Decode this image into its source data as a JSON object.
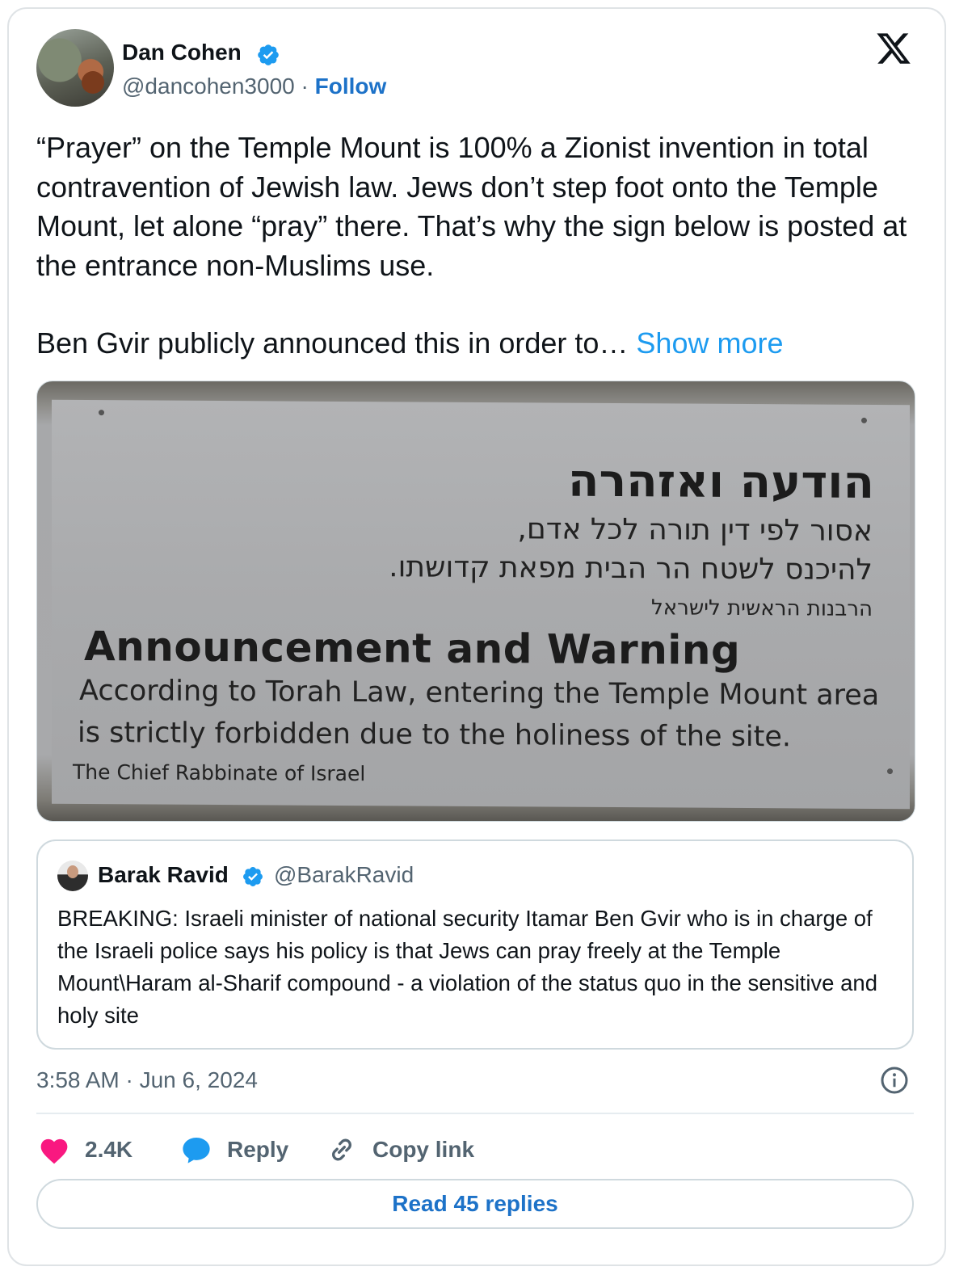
{
  "author": {
    "name": "Dan Cohen",
    "handle": "@dancohen3000",
    "separator": "·",
    "follow_label": "Follow"
  },
  "tweet": {
    "text": "“Prayer” on the Temple Mount is 100% a Zionist invention in total contravention of Jewish law. Jews don’t step foot onto the Temple Mount, let alone “pray” there. That’s why the sign below is posted at the entrance non-Muslims use.",
    "text2": "Ben Gvir publicly announced this in order to…",
    "show_more": "Show more"
  },
  "photo": {
    "hebrew_title": "הודעה ואזהרה",
    "hebrew_line1": "אסור לפי דין תורה לכל אדם,",
    "hebrew_line2": "להיכנס לשטח הר הבית מפאת קדושתו.",
    "hebrew_line3": "הרבנות הראשית לישראל",
    "english_title": "Announcement and Warning",
    "english_line1": "According to Torah Law, entering the Temple Mount area",
    "english_line2": "is strictly forbidden due to the holiness of the site.",
    "english_line3": "The Chief Rabbinate of Israel"
  },
  "quoted_tweet": {
    "name": "Barak Ravid",
    "handle": "@BarakRavid",
    "text": "BREAKING: Israeli minister of national security Itamar Ben Gvir who is in charge of the Israeli police says his policy is that Jews can pray freely at the Temple Mount\\Haram al-Sharif compound - a violation of the status quo in the sensitive and holy site"
  },
  "timestamp": "3:58 AM · Jun 6, 2024",
  "actions": {
    "likes": "2.4K",
    "reply_label": "Reply",
    "copy_link_label": "Copy link"
  },
  "read_replies_label": "Read 45 replies",
  "colors": {
    "link_blue": "#1d9bf0",
    "follow_blue": "#1d72c8",
    "heart_red": "#f91880",
    "reply_blue": "#1d9bf0",
    "muted": "#536471"
  }
}
